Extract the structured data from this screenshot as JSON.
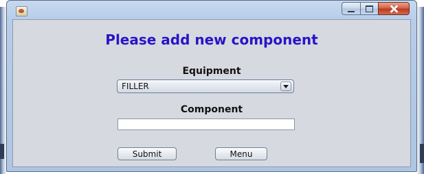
{
  "window": {
    "controls": {
      "minimize_icon": "minimize-icon",
      "maximize_icon": "maximize-icon",
      "close_icon": "close-icon"
    },
    "app_icon": "java-app-icon"
  },
  "form": {
    "heading": "Please add new component",
    "equipment_label": "Equipment",
    "equipment_selected": "FILLER",
    "component_label": "Component",
    "component_value": "",
    "submit_label": "Submit",
    "menu_label": "Menu"
  },
  "colors": {
    "heading": "#2a13c8",
    "client_background": "#d6d9df",
    "close_button": "#c0391f"
  }
}
